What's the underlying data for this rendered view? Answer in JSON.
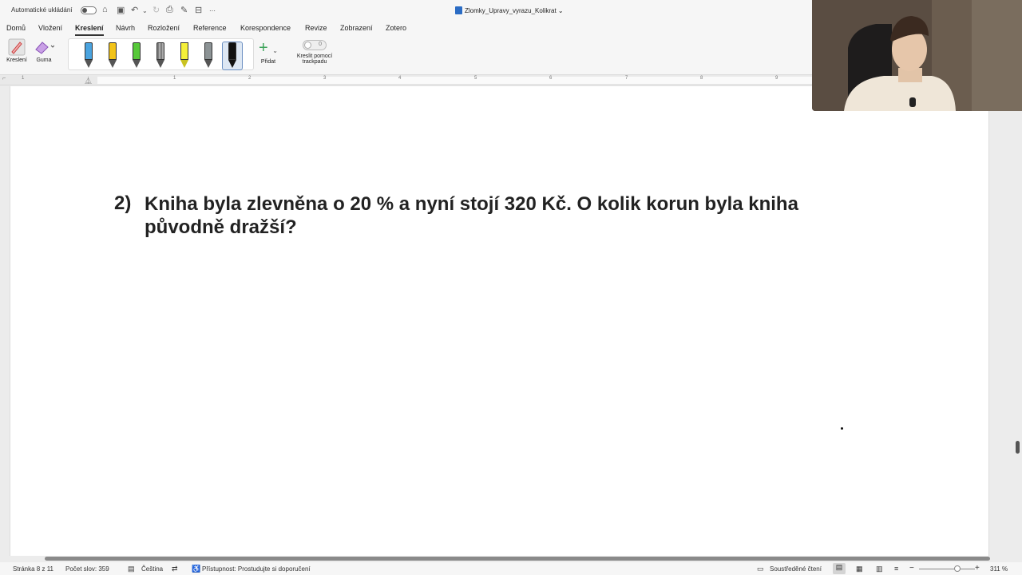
{
  "titlebar": {
    "autosave_label": "Automatické ukládání",
    "document_title": "Zlomky_Upravy_vyrazu_Kolikrat"
  },
  "tabs": [
    "Domů",
    "Vložení",
    "Kreslení",
    "Návrh",
    "Rozložení",
    "Reference",
    "Korespondence",
    "Revize",
    "Zobrazení",
    "Zotero"
  ],
  "active_tab": "Kreslení",
  "ribbon": {
    "draw_label": "Kreslení",
    "eraser_label": "Guma",
    "add_label": "Přidat",
    "trackpad_label_1": "Kreslit pomocí",
    "trackpad_label_2": "trackpadu",
    "trackpad_toggle": "0",
    "pens": [
      {
        "name": "blue-pen",
        "color": "#4aa3df"
      },
      {
        "name": "yellow-pen",
        "color": "#f2c318"
      },
      {
        "name": "green-pen",
        "color": "#57c93a"
      },
      {
        "name": "gray-pencil",
        "color": "#7d7d7d"
      },
      {
        "name": "yellow-highlighter",
        "color": "#f5f03a"
      },
      {
        "name": "gray-pen",
        "color": "#8c9395"
      },
      {
        "name": "black-pen",
        "color": "#111111"
      }
    ],
    "selected_pen": "black-pen"
  },
  "ruler": {
    "numbers": [
      "1",
      "1",
      "2",
      "3",
      "4",
      "5",
      "6",
      "7",
      "8",
      "9"
    ]
  },
  "document": {
    "question_number": "2)",
    "question_line_1": "Kniha byla zlevněna o 20 % a nyní stojí 320 Kč. O kolik korun byla kniha",
    "question_line_2": "původně dražší?"
  },
  "statusbar": {
    "page": "Stránka 8 z 11",
    "word_count": "Počet slov: 359",
    "language": "Čeština",
    "accessibility": "Přístupnost: Prostudujte si doporučení",
    "focus": "Soustředěné čtení",
    "zoom": "311 %"
  }
}
